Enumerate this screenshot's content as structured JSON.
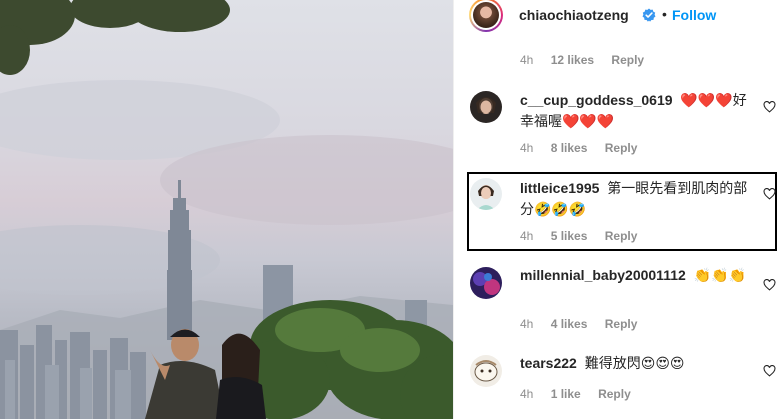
{
  "post": {
    "username": "chiaochiaotzeng",
    "separator": "•",
    "follow_label": "Follow"
  },
  "first_meta": {
    "time": "4h",
    "likes": "12 likes",
    "reply": "Reply"
  },
  "comments": [
    {
      "username": "c__cup_goddess_0619",
      "text": "❤️❤️❤️好幸福喔❤️❤️❤️",
      "time": "4h",
      "likes": "8 likes",
      "reply": "Reply"
    },
    {
      "username": "littleice1995",
      "text": "第一眼先看到肌肉的部分🤣🤣🤣",
      "time": "4h",
      "likes": "5 likes",
      "reply": "Reply"
    },
    {
      "username": "millennial_baby20001112",
      "text": "👏👏👏",
      "time": "4h",
      "likes": "4 likes",
      "reply": "Reply"
    },
    {
      "username": "tears222",
      "text": "難得放閃😍😍😍",
      "time": "4h",
      "likes": "1 like",
      "reply": "Reply"
    }
  ],
  "icons": {
    "verified": "verified-badge-icon",
    "heart": "heart-outline-icon"
  },
  "colors": {
    "follow": "#0095f6",
    "muted": "#8e8e8e",
    "text": "#262626"
  }
}
